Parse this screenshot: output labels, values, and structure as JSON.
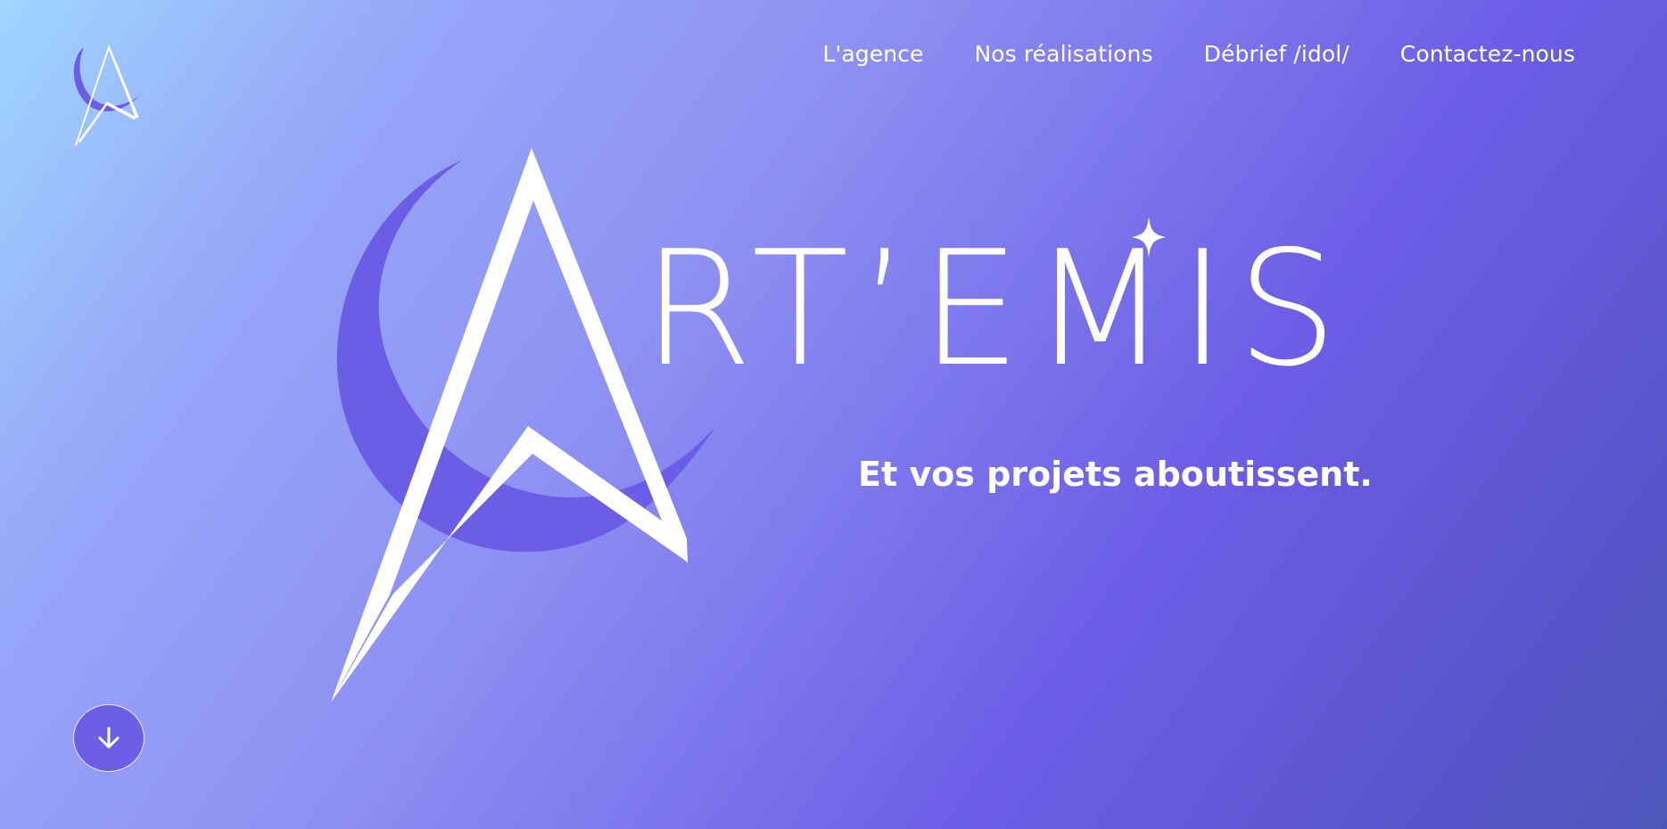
{
  "brand": {
    "name": "ART'EMIS",
    "wordmark_text": "RT’EMIS",
    "tagline": "Et vos projets aboutissent.",
    "logo_icon": "artemis-logo-icon",
    "accent_color": "#6b5de6"
  },
  "nav": {
    "items": [
      {
        "label": "L'agence"
      },
      {
        "label": "Nos réalisations"
      },
      {
        "label": "Débrief /idol/"
      },
      {
        "label": "Contactez-nous"
      }
    ]
  },
  "scroll": {
    "icon": "arrow-down-icon"
  }
}
